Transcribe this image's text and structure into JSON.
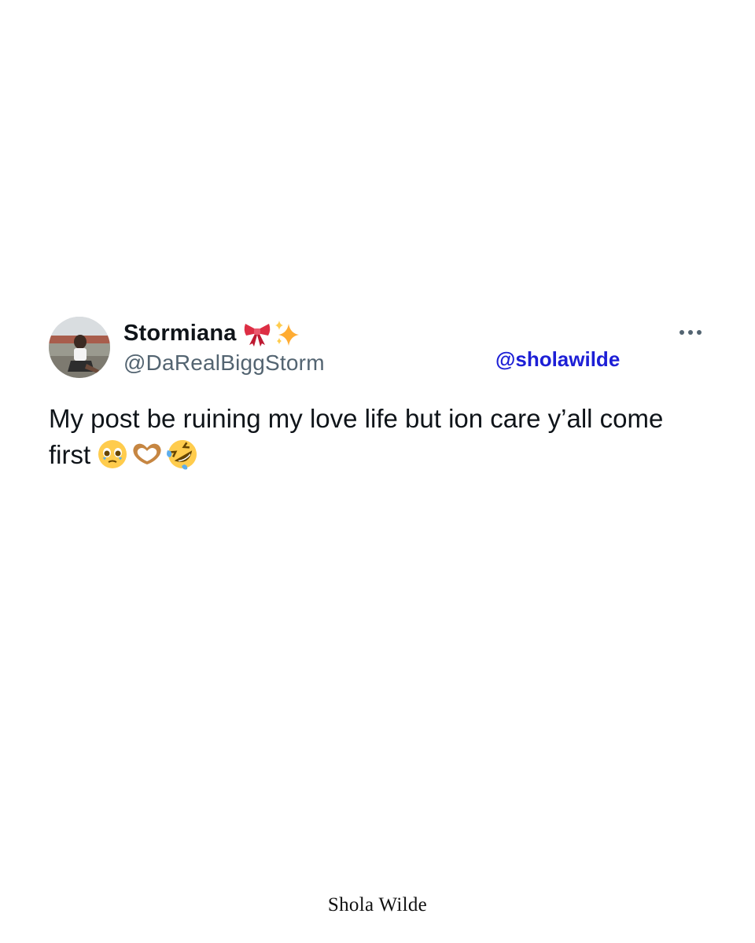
{
  "tweet": {
    "author": {
      "display_name": "Stormiana",
      "name_icons": [
        "ribbon-bow-icon",
        "sparkles-icon"
      ],
      "handle": "@DaRealBiggStorm",
      "avatar": "profile-photo"
    },
    "text_line1": "My post be ruining my love life but ion care y’all come",
    "text_line2": "first",
    "text_emojis": [
      "pleading-face-icon",
      "heart-hands-icon",
      "rolling-laughing-icon"
    ],
    "more_icon": "more-dots-icon"
  },
  "overlay": {
    "watermark": "@sholawilde"
  },
  "footer": {
    "signature": "Shola Wilde"
  },
  "colors": {
    "text": "#0f1419",
    "handle": "#536471",
    "watermark": "#1d1fd6",
    "background": "#ffffff"
  }
}
